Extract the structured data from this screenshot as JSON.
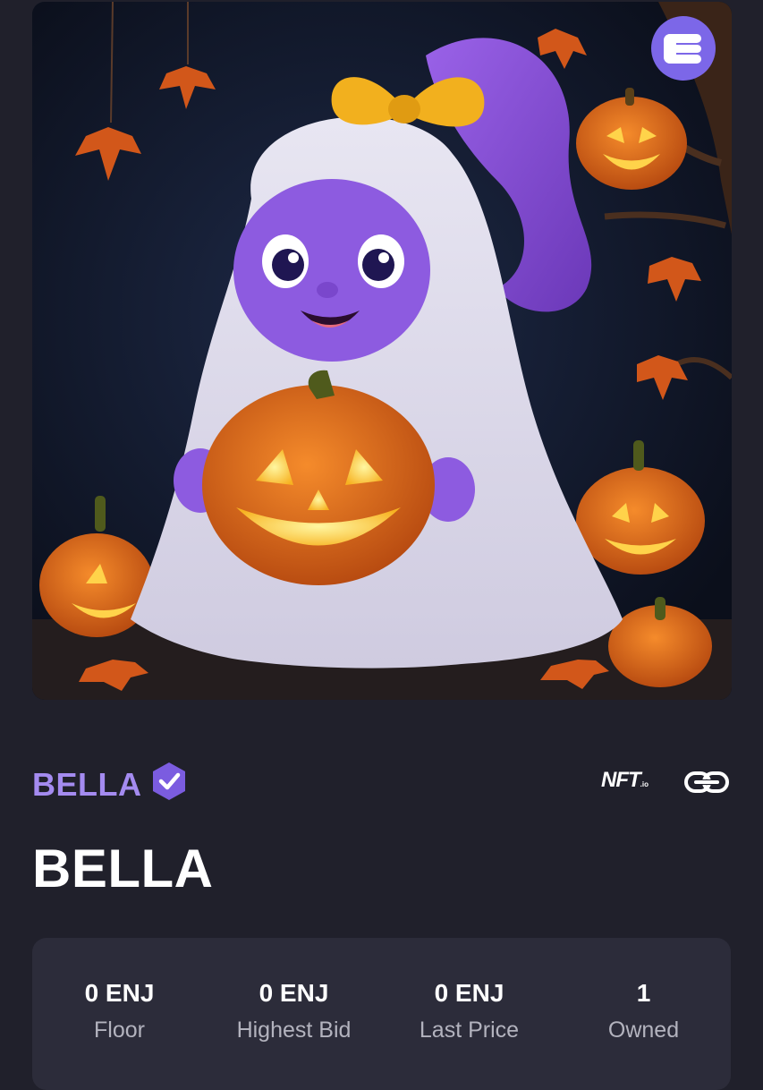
{
  "nft": {
    "collection_name": "BELLA",
    "title": "BELLA",
    "image_subject": "Purple-faced ghost girl with yellow bow holding a glowing jack-o-lantern",
    "marketplace_logo": "NFT",
    "marketplace_logo_suffix": ".io",
    "icons": [
      "enjin-logo-icon",
      "verified-badge-icon",
      "nftio-logo",
      "link-icon"
    ]
  },
  "stats": [
    {
      "value": "0 ENJ",
      "label": "Floor"
    },
    {
      "value": "0 ENJ",
      "label": "Highest Bid"
    },
    {
      "value": "0 ENJ",
      "label": "Last Price"
    },
    {
      "value": "1",
      "label": "Owned"
    }
  ],
  "colors": {
    "background": "#20202b",
    "card": "#2c2c3a",
    "accent": "#a48bf0",
    "badge": "#7b5ce0",
    "enjin_logo": "#7c67e8"
  }
}
